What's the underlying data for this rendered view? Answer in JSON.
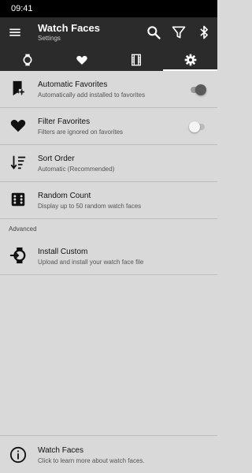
{
  "status_bar": {
    "time": "09:41"
  },
  "app_bar": {
    "title": "Watch Faces",
    "subtitle": "Settings"
  },
  "tabs": [
    {
      "icon": "watch-icon"
    },
    {
      "icon": "heart-icon"
    },
    {
      "icon": "film-icon"
    },
    {
      "icon": "gear-icon",
      "active": true
    }
  ],
  "settings": [
    {
      "label": "Automatic Favorites",
      "desc": "Automatically add installed to favorites",
      "icon": "bookmark-add-icon",
      "toggle": true
    },
    {
      "label": "Filter Favorites",
      "desc": "Filters are ignored on favorites",
      "icon": "heart-icon",
      "toggle": false
    },
    {
      "label": "Sort Order",
      "desc": "Automatic (Recommended)",
      "icon": "sort-icon"
    },
    {
      "label": "Random Count",
      "desc": "Display up to 50 random watch faces",
      "icon": "dice-icon"
    }
  ],
  "advanced": {
    "header": "Advanced",
    "items": [
      {
        "label": "Install Custom",
        "desc": "Upload and install your watch face file",
        "icon": "install-watch-icon"
      }
    ]
  },
  "footer": {
    "label": "Watch Faces",
    "desc": "Click to learn more about watch faces.",
    "icon": "info-icon"
  },
  "colors": {
    "app_bar": "#2b2b2b",
    "background": "#d9d9d9",
    "status_bar": "#000000"
  }
}
